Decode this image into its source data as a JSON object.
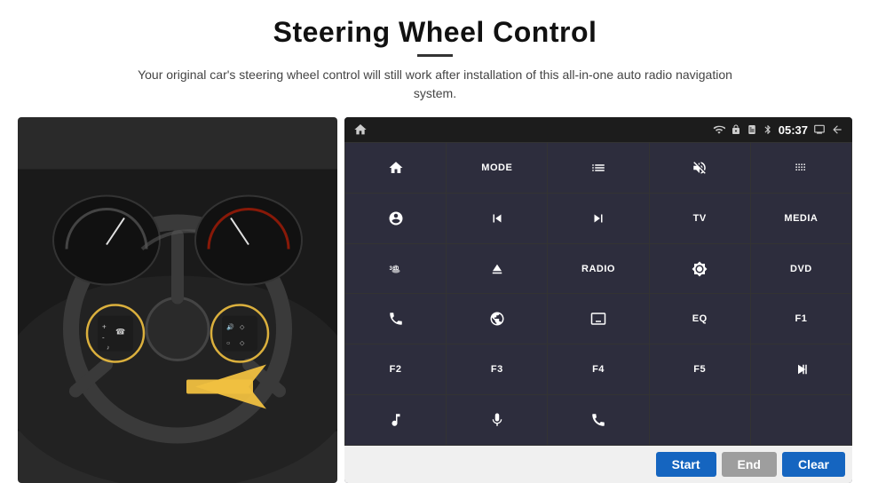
{
  "header": {
    "title": "Steering Wheel Control",
    "subtitle": "Your original car's steering wheel control will still work after installation of this all-in-one auto radio navigation system.",
    "divider": true
  },
  "status_bar": {
    "time": "05:37",
    "icons": [
      "wifi",
      "lock",
      "sim",
      "bluetooth",
      "screen",
      "back"
    ]
  },
  "control_buttons": [
    {
      "id": "row1",
      "buttons": [
        {
          "label": "",
          "icon": "home",
          "type": "icon"
        },
        {
          "label": "MODE",
          "icon": "",
          "type": "text"
        },
        {
          "label": "",
          "icon": "list",
          "type": "icon"
        },
        {
          "label": "",
          "icon": "mute",
          "type": "icon"
        },
        {
          "label": "",
          "icon": "dots",
          "type": "icon"
        }
      ]
    },
    {
      "id": "row2",
      "buttons": [
        {
          "label": "",
          "icon": "settings",
          "type": "icon"
        },
        {
          "label": "",
          "icon": "prev",
          "type": "icon"
        },
        {
          "label": "",
          "icon": "next",
          "type": "icon"
        },
        {
          "label": "TV",
          "icon": "",
          "type": "text"
        },
        {
          "label": "MEDIA",
          "icon": "",
          "type": "text"
        }
      ]
    },
    {
      "id": "row3",
      "buttons": [
        {
          "label": "360",
          "icon": "",
          "type": "text-small"
        },
        {
          "label": "",
          "icon": "eject",
          "type": "icon"
        },
        {
          "label": "RADIO",
          "icon": "",
          "type": "text"
        },
        {
          "label": "",
          "icon": "brightness",
          "type": "icon"
        },
        {
          "label": "DVD",
          "icon": "",
          "type": "text"
        }
      ]
    },
    {
      "id": "row4",
      "buttons": [
        {
          "label": "",
          "icon": "phone",
          "type": "icon"
        },
        {
          "label": "",
          "icon": "globe",
          "type": "icon"
        },
        {
          "label": "",
          "icon": "display",
          "type": "icon"
        },
        {
          "label": "EQ",
          "icon": "",
          "type": "text"
        },
        {
          "label": "F1",
          "icon": "",
          "type": "text"
        }
      ]
    },
    {
      "id": "row5",
      "buttons": [
        {
          "label": "F2",
          "icon": "",
          "type": "text"
        },
        {
          "label": "F3",
          "icon": "",
          "type": "text"
        },
        {
          "label": "F4",
          "icon": "",
          "type": "text"
        },
        {
          "label": "F5",
          "icon": "",
          "type": "text"
        },
        {
          "label": "",
          "icon": "playpause",
          "type": "icon"
        }
      ]
    },
    {
      "id": "row6",
      "buttons": [
        {
          "label": "",
          "icon": "music",
          "type": "icon"
        },
        {
          "label": "",
          "icon": "mic",
          "type": "icon"
        },
        {
          "label": "",
          "icon": "hangup",
          "type": "icon"
        },
        {
          "label": "",
          "icon": "",
          "type": "empty"
        },
        {
          "label": "",
          "icon": "",
          "type": "empty"
        }
      ]
    }
  ],
  "action_buttons": {
    "start": "Start",
    "end": "End",
    "clear": "Clear"
  }
}
